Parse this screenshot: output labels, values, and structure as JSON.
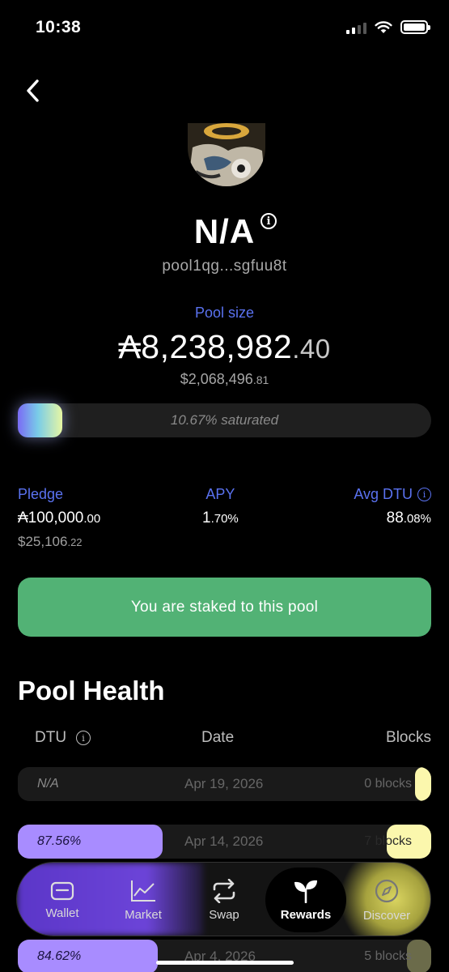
{
  "status_bar": {
    "time": "10:38"
  },
  "pool": {
    "name": "N/A",
    "id": "pool1qg...sgfuu8t",
    "size_label": "Pool size",
    "size_main": "₳8,238,982",
    "size_decimal": ".40",
    "usd_main": "$2,068,496",
    "usd_decimal": ".81",
    "saturation_text": "10.67% saturated",
    "saturation_fraction": 0.1067
  },
  "stats": {
    "pledge": {
      "label": "Pledge",
      "value_main": "₳100,000",
      "value_decimal": ".00",
      "usd_main": "$25,106",
      "usd_decimal": ".22"
    },
    "apy": {
      "label": "APY",
      "value_main": "1",
      "value_decimal": ".70%"
    },
    "avg_dtu": {
      "label": "Avg DTU",
      "value_main": "88",
      "value_decimal": ".08%"
    }
  },
  "staked_button": "You are staked to this pool",
  "health": {
    "title": "Pool Health",
    "columns": {
      "dtu": "DTU",
      "date": "Date",
      "blocks": "Blocks"
    },
    "rows": [
      {
        "dtu": "N/A",
        "date": "Apr 19, 2026",
        "blocks": "0 blocks",
        "dtu_fraction": 0
      },
      {
        "dtu": "87.56%",
        "date": "Apr 14, 2026",
        "blocks": "7 blocks",
        "dtu_fraction": 0.8756
      },
      {
        "dtu": "84.62%",
        "date": "Apr 4, 2026",
        "blocks": "5 blocks",
        "dtu_fraction": 0.8462
      }
    ]
  },
  "tabs": [
    {
      "label": "Wallet",
      "icon": "wallet-icon"
    },
    {
      "label": "Market",
      "icon": "chart-icon"
    },
    {
      "label": "Swap",
      "icon": "swap-icon"
    },
    {
      "label": "Rewards",
      "icon": "sprout-icon",
      "active": true
    },
    {
      "label": "Discover",
      "icon": "compass-icon"
    }
  ],
  "colors": {
    "accent_blue": "#5a72f0",
    "staked_green": "#52b275",
    "dtu_purple": "#a88cff",
    "blocks_yellow": "#fbf7ad"
  }
}
